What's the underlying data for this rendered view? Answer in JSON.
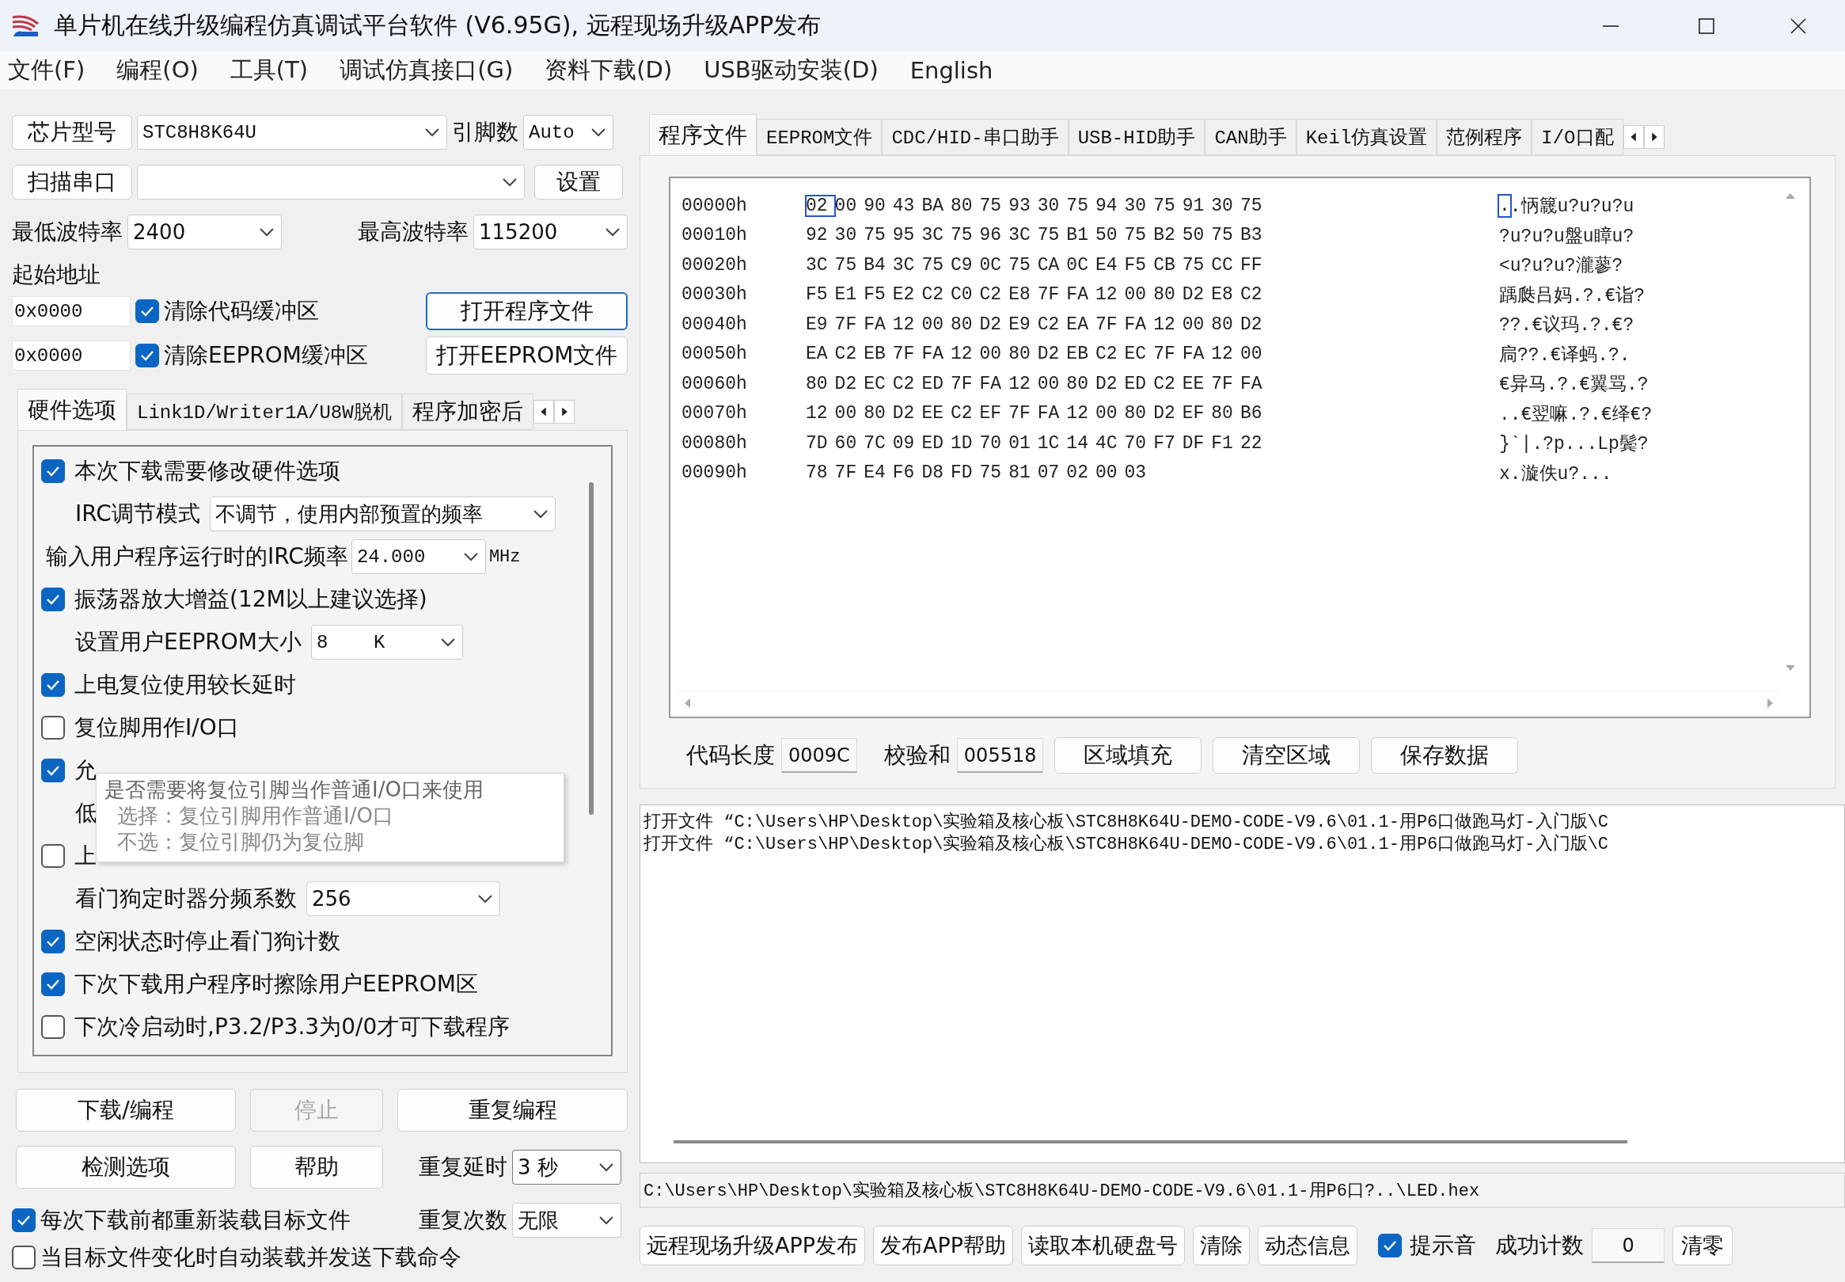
{
  "window": {
    "title": "单片机在线升级编程仿真调试平台软件 (V6.95G), 远程现场升级APP发布"
  },
  "menu": [
    {
      "label": "文件(F)"
    },
    {
      "label": "编程(O)"
    },
    {
      "label": "工具(T)"
    },
    {
      "label": "调试仿真接口(G)"
    },
    {
      "label": "资料下载(D)"
    },
    {
      "label": "USB驱动安装(D)"
    },
    {
      "label": "English"
    }
  ],
  "chip": {
    "button": "芯片型号",
    "value": "STC8H8K64U",
    "pins_label": "引脚数",
    "pins_value": "Auto"
  },
  "port": {
    "button": "扫描串口",
    "settings_button": "设置"
  },
  "baud": {
    "min_label": "最低波特率",
    "min_value": "2400",
    "max_label": "最高波特率",
    "max_value": "115200"
  },
  "start_address": {
    "label": "起始地址",
    "rows": [
      {
        "value": "0x0000",
        "option": "清除代码缓冲区",
        "checked": true,
        "button": "打开程序文件",
        "focused": true
      },
      {
        "value": "0x0000",
        "option": "清除EEPROM缓冲区",
        "checked": true,
        "button": "打开EEPROM文件",
        "focused": false
      }
    ]
  },
  "left_tabs": [
    {
      "label": "硬件选项",
      "selected": true
    },
    {
      "label": "Link1D/Writer1A/U8W脱机",
      "selected": false
    },
    {
      "label": "程序加密后",
      "selected": false
    }
  ],
  "hardware_options": [
    {
      "kind": "checkbox",
      "label": "本次下载需要修改硬件选项",
      "checked": true
    },
    {
      "kind": "select",
      "label": "IRC调节模式",
      "value": "不调节，使用内部预置的频率"
    },
    {
      "kind": "input",
      "label": "输入用户程序运行时的IRC频率",
      "value": "24.000",
      "unit": "MHz"
    },
    {
      "kind": "checkbox",
      "label": "振荡器放大增益(12M以上建议选择)",
      "checked": true
    },
    {
      "kind": "select",
      "label": "设置用户EEPROM大小",
      "value": "8    K"
    },
    {
      "kind": "checkbox",
      "label": "上电复位使用较长延时",
      "checked": true
    },
    {
      "kind": "checkbox",
      "label": "复位脚用作I/O口",
      "checked": false
    },
    {
      "kind": "checkbox",
      "label": "允",
      "checked": true
    },
    {
      "kind": "text",
      "label": "低"
    },
    {
      "kind": "checkbox",
      "label": "上",
      "checked": false
    },
    {
      "kind": "select",
      "label": "看门狗定时器分频系数",
      "value": "256"
    },
    {
      "kind": "checkbox",
      "label": "空闲状态时停止看门狗计数",
      "checked": true
    },
    {
      "kind": "checkbox",
      "label": "下次下载用户程序时擦除用户EEPROM区",
      "checked": true
    },
    {
      "kind": "checkbox",
      "label": "下次冷启动时,P3.2/P3.3为0/0才可下载程序",
      "checked": false
    }
  ],
  "tooltip": {
    "lines": [
      "是否需要将复位引脚当作普通I/O口来使用",
      "选择：复位引脚用作普通I/O口",
      "不选：复位引脚仍为复位脚"
    ]
  },
  "program_buttons": [
    {
      "label": "下载/编程",
      "disabled": false
    },
    {
      "label": "停止",
      "disabled": true
    },
    {
      "label": "重复编程",
      "disabled": false
    },
    {
      "label": "检测选项",
      "disabled": false
    },
    {
      "label": "帮助",
      "disabled": false
    }
  ],
  "repeat": [
    {
      "label": "重复延时",
      "value": "3 秒"
    },
    {
      "label": "重复次数",
      "value": "无限"
    }
  ],
  "reload_options": [
    {
      "label": "每次下载前都重新装载目标文件",
      "checked": true
    },
    {
      "label": "当目标文件变化时自动装载并发送下载命令",
      "checked": false
    }
  ],
  "right_tabs": [
    {
      "label": "程序文件",
      "selected": true
    },
    {
      "label": "EEPROM文件",
      "selected": false
    },
    {
      "label": "CDC/HID-串口助手",
      "selected": false
    },
    {
      "label": "USB-HID助手",
      "selected": false
    },
    {
      "label": "CAN助手",
      "selected": false
    },
    {
      "label": "Keil仿真设置",
      "selected": false
    },
    {
      "label": "范例程序",
      "selected": false
    },
    {
      "label": "I/O口配",
      "selected": false
    }
  ],
  "hex_view": {
    "rows": [
      {
        "address": "00000h",
        "bytes": [
          "02",
          "00",
          "90",
          "43",
          "BA",
          "80",
          "75",
          "93",
          "30",
          "75",
          "94",
          "30",
          "75",
          "91",
          "30",
          "75"
        ],
        "ascii": "..怲簚u?u?u?u",
        "cursor": true
      },
      {
        "address": "00010h",
        "bytes": [
          "92",
          "30",
          "75",
          "95",
          "3C",
          "75",
          "96",
          "3C",
          "75",
          "B1",
          "50",
          "75",
          "B2",
          "50",
          "75",
          "B3"
        ],
        "ascii": "?u?u?u盤u瞕u?",
        "cursor": false
      },
      {
        "address": "00020h",
        "bytes": [
          "3C",
          "75",
          "B4",
          "3C",
          "75",
          "C9",
          "0C",
          "75",
          "CA",
          "0C",
          "E4",
          "F5",
          "CB",
          "75",
          "CC",
          "FF"
        ],
        "ascii": "<u?u?u?瀧蓼?",
        "cursor": false
      },
      {
        "address": "00030h",
        "bytes": [
          "F5",
          "E1",
          "F5",
          "E2",
          "C2",
          "C0",
          "C2",
          "E8",
          "7F",
          "FA",
          "12",
          "00",
          "80",
          "D2",
          "E8",
          "C2"
        ],
        "ascii": "踽瓞吕妈.?.€诣?",
        "cursor": false
      },
      {
        "address": "00040h",
        "bytes": [
          "E9",
          "7F",
          "FA",
          "12",
          "00",
          "80",
          "D2",
          "E9",
          "C2",
          "EA",
          "7F",
          "FA",
          "12",
          "00",
          "80",
          "D2"
        ],
        "ascii": "??.€议玛.?.€?",
        "cursor": false
      },
      {
        "address": "00050h",
        "bytes": [
          "EA",
          "C2",
          "EB",
          "7F",
          "FA",
          "12",
          "00",
          "80",
          "D2",
          "EB",
          "C2",
          "EC",
          "7F",
          "FA",
          "12",
          "00"
        ],
        "ascii": "扃??.€译蚂.?.",
        "cursor": false
      },
      {
        "address": "00060h",
        "bytes": [
          "80",
          "D2",
          "EC",
          "C2",
          "ED",
          "7F",
          "FA",
          "12",
          "00",
          "80",
          "D2",
          "ED",
          "C2",
          "EE",
          "7F",
          "FA"
        ],
        "ascii": "€异马.?.€翼骂.?",
        "cursor": false
      },
      {
        "address": "00070h",
        "bytes": [
          "12",
          "00",
          "80",
          "D2",
          "EE",
          "C2",
          "EF",
          "7F",
          "FA",
          "12",
          "00",
          "80",
          "D2",
          "EF",
          "80",
          "B6"
        ],
        "ascii": "..€翌嘛.?.€绎€?",
        "cursor": false
      },
      {
        "address": "00080h",
        "bytes": [
          "7D",
          "60",
          "7C",
          "09",
          "ED",
          "1D",
          "70",
          "01",
          "1C",
          "14",
          "4C",
          "70",
          "F7",
          "DF",
          "F1",
          "22"
        ],
        "ascii": "}`|.?p...Lp鬓?",
        "cursor": false
      },
      {
        "address": "00090h",
        "bytes": [
          "78",
          "7F",
          "E4",
          "F6",
          "D8",
          "FD",
          "75",
          "81",
          "07",
          "02",
          "00",
          "03"
        ],
        "ascii": "x.漩佚u?...",
        "cursor": false
      }
    ]
  },
  "code_info": {
    "length_label": "代码长度",
    "length": "0009C",
    "checksum_label": "校验和",
    "checksum": "005518",
    "buttons": [
      "区域填充",
      "清空区域",
      "保存数据"
    ]
  },
  "log": {
    "lines": [
      "打开文件 “C:\\Users\\HP\\Desktop\\实验箱及核心板\\STC8H8K64U-DEMO-CODE-V9.6\\01.1-用P6口做跑马灯-入门版\\C",
      "打开文件 “C:\\Users\\HP\\Desktop\\实验箱及核心板\\STC8H8K64U-DEMO-CODE-V9.6\\01.1-用P6口做跑马灯-入门版\\C"
    ]
  },
  "path": "C:\\Users\\HP\\Desktop\\实验箱及核心板\\STC8H8K64U-DEMO-CODE-V9.6\\01.1-用P6口?..\\LED.hex",
  "footer": {
    "buttons": [
      "远程现场升级APP发布",
      "发布APP帮助",
      "读取本机硬盘号",
      "清除",
      "动态信息"
    ],
    "sound": {
      "label": "提示音",
      "checked": true
    },
    "count_label": "成功计数",
    "count": "0",
    "reset_button": "清零"
  }
}
